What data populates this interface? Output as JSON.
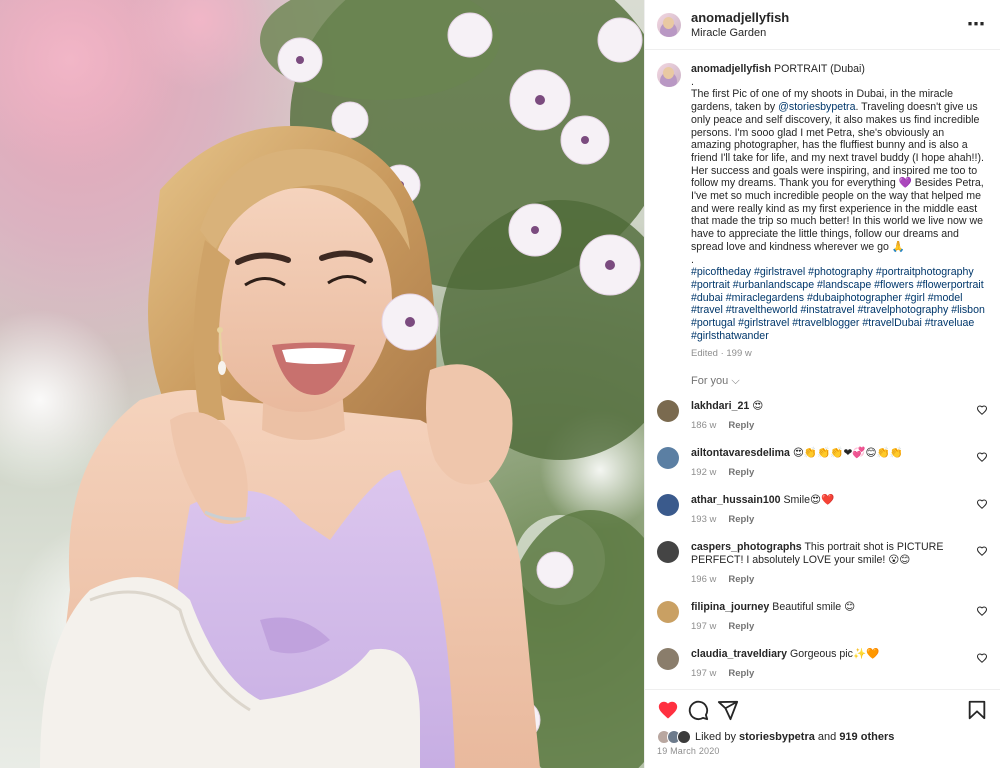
{
  "post": {
    "username": "anomadjellyfish",
    "location": "Miracle Garden",
    "caption_title": "PORTRAIT (Dubai)",
    "caption_dot1": ".",
    "caption_p1": "The first Pic of one of my shoots in Dubai, in the miracle gardens, taken by ",
    "caption_mention": "@storiesbypetra",
    "caption_p2": ". Traveling doesn't give us only peace and self discovery, it also makes us find incredible persons. I'm sooo glad I met Petra, she's obviously an amazing photographer, has the fluffiest bunny and is also a friend I'll take for life, and my next travel buddy (I hope ahah!!). Her success and goals were inspiring, and inspired me too to follow my dreams. Thank you for everything 💜 Besides Petra, I've met so much incredible people on the way that helped me and were really kind as my first experience in the middle east that made the trip so much better! In this world we live now we have to appreciate the little things, follow our dreams and spread love and kindness wherever we go 🙏",
    "caption_dot2": ".",
    "hashtags": "#picoftheday #girlstravel #photography #portraitphotography #portrait #urbanlandscape #landscape #flowers #flowerportrait #dubai #miraclegardens #dubaiphotographer #girl #model #travel #traveltheworld #instatravel #travelphotography #lisbon #portugal #girlstravel #travelblogger #travelDubai #traveluae #girlsthatwander",
    "edited": "Edited · 199 w",
    "more_icon": "⋯"
  },
  "for_you": "For you ⌵",
  "comments": [
    {
      "user": "lakhdari_21",
      "text": "😍",
      "age": "186 w",
      "reply": "Reply",
      "avatar_color": "#7a6a4f",
      "tall": false
    },
    {
      "user": "ailtontavaresdelima",
      "text": "😍👏👏👏❤💞😊👏👏",
      "age": "192 w",
      "reply": "Reply",
      "avatar_color": "#5b7fa3",
      "tall": false
    },
    {
      "user": "athar_hussain100",
      "text": "Smile😍❤️",
      "age": "193 w",
      "reply": "Reply",
      "avatar_color": "#3a5a8c",
      "tall": false
    },
    {
      "user": "caspers_photographs",
      "text": "This portrait shot is PICTURE PERFECT! I absolutely LOVE your smile! 😮😊",
      "age": "196 w",
      "reply": "Reply",
      "avatar_color": "#444444",
      "tall": true
    },
    {
      "user": "filipina_journey",
      "text": "Beautiful smile 😊",
      "age": "197 w",
      "reply": "Reply",
      "avatar_color": "#c9a063",
      "tall": false
    },
    {
      "user": "claudia_traveldiary",
      "text": "Gorgeous pic✨🧡",
      "age": "197 w",
      "reply": "Reply",
      "avatar_color": "#8a7d6b",
      "tall": false
    }
  ],
  "likes": {
    "prefix": "Liked by ",
    "user": "storiesbypetra",
    "middle": " and ",
    "others": "919 others"
  },
  "date": "19 March 2020",
  "colors": {
    "like_red": "#ff3040",
    "link_blue": "#00376b",
    "muted": "#8e8e8e"
  },
  "icons": [
    "heart-filled-icon",
    "comment-icon",
    "share-icon",
    "bookmark-icon",
    "more-icon",
    "comment-like-icon"
  ]
}
